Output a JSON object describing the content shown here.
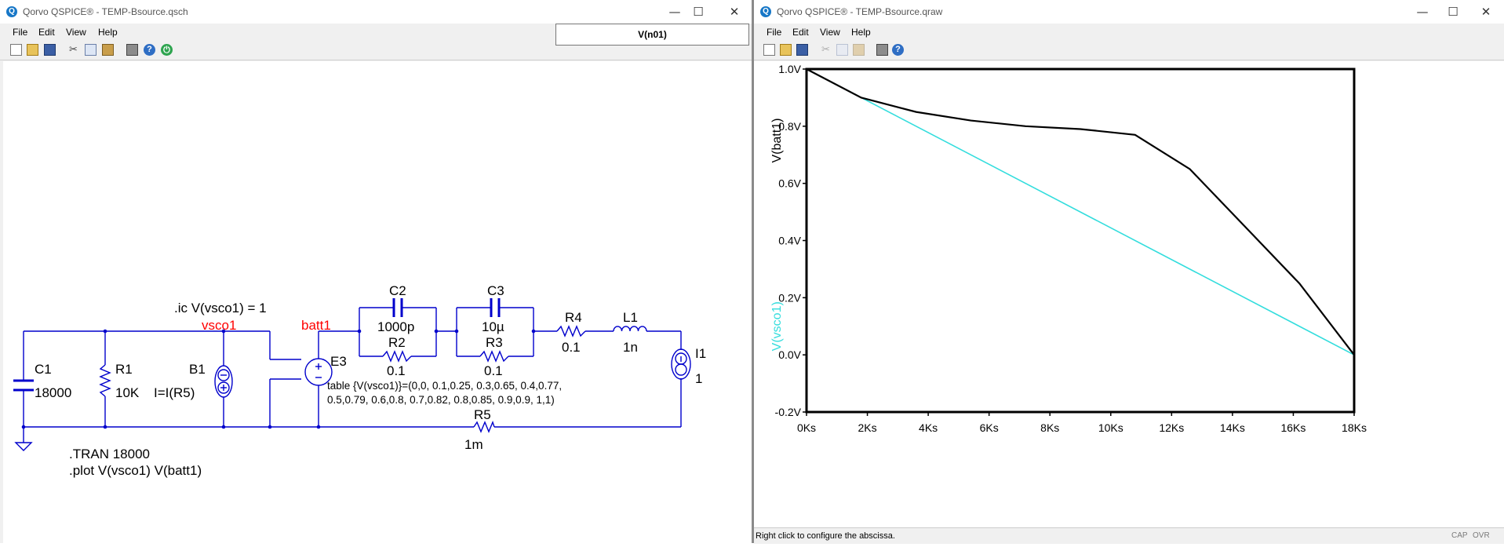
{
  "left_window": {
    "title": "Qorvo QSPICE® - TEMP-Bsource.qsch",
    "menu": [
      "File",
      "Edit",
      "View",
      "Help"
    ],
    "node_readout": "V(n01)"
  },
  "right_window": {
    "title": "Qorvo QSPICE® - TEMP-Bsource.qraw",
    "menu": [
      "File",
      "Edit",
      "View",
      "Help"
    ],
    "status": "Right click to configure the abscissa.",
    "indicators": [
      "CAP",
      "OVR"
    ]
  },
  "window_controls": {
    "minimize": "—",
    "maximize": "☐",
    "close": "✕"
  },
  "schematic": {
    "ic_directive": ".ic V(vsco1) = 1",
    "net_vsco1": "vsco1",
    "net_batt1": "batt1",
    "C1": {
      "name": "C1",
      "value": "18000"
    },
    "R1": {
      "name": "R1",
      "value": "10K"
    },
    "B1": {
      "name": "B1",
      "value": "I=I(R5)"
    },
    "E3": {
      "name": "E3",
      "table_line1": "table {V(vsco1)}=(0,0, 0.1,0.25, 0.3,0.65, 0.4,0.77,",
      "table_line2": "0.5,0.79, 0.6,0.8, 0.7,0.82, 0.8,0.85, 0.9,0.9, 1,1)"
    },
    "C2": {
      "name": "C2",
      "value": "1000p"
    },
    "R2": {
      "name": "R2",
      "value": "0.1"
    },
    "C3": {
      "name": "C3",
      "value": "10µ"
    },
    "R3": {
      "name": "R3",
      "value": "0.1"
    },
    "R4": {
      "name": "R4",
      "value": "0.1"
    },
    "L1": {
      "name": "L1",
      "value": "1n"
    },
    "I1": {
      "name": "I1",
      "value": "1"
    },
    "R5": {
      "name": "R5",
      "value": "1m"
    },
    "tran_directive": ".TRAN 18000",
    "plot_directive": ".plot V(vsco1) V(batt1)",
    "wire_color": "#0000cc",
    "net_label_color": "#ff0000"
  },
  "chart_data": {
    "type": "line",
    "x_tick_labels": [
      "0Ks",
      "2Ks",
      "4Ks",
      "6Ks",
      "8Ks",
      "10Ks",
      "12Ks",
      "14Ks",
      "16Ks",
      "18Ks"
    ],
    "y_tick_labels": [
      "1.0V",
      "0.8V",
      "0.6V",
      "0.4V",
      "0.2V",
      "0.0V",
      "-0.2V"
    ],
    "xlim": [
      0,
      18000
    ],
    "ylim": [
      -0.2,
      1.0
    ],
    "y_ticks": [
      1.0,
      0.8,
      0.6,
      0.4,
      0.2,
      0.0,
      -0.2
    ],
    "x_ticks": [
      0,
      2000,
      4000,
      6000,
      8000,
      10000,
      12000,
      14000,
      16000,
      18000
    ],
    "series": [
      {
        "name": "V(batt1)",
        "color": "#000000",
        "x": [
          0,
          1800,
          3600,
          5400,
          7200,
          9000,
          10800,
          12600,
          14400,
          16200,
          18000
        ],
        "y": [
          1.0,
          0.9,
          0.85,
          0.82,
          0.8,
          0.79,
          0.77,
          0.65,
          0.45,
          0.25,
          0.0
        ]
      },
      {
        "name": "V(vsco1)",
        "color": "#33dddd",
        "x": [
          0,
          18000
        ],
        "y": [
          1.0,
          0.0
        ]
      }
    ],
    "grid": false
  }
}
